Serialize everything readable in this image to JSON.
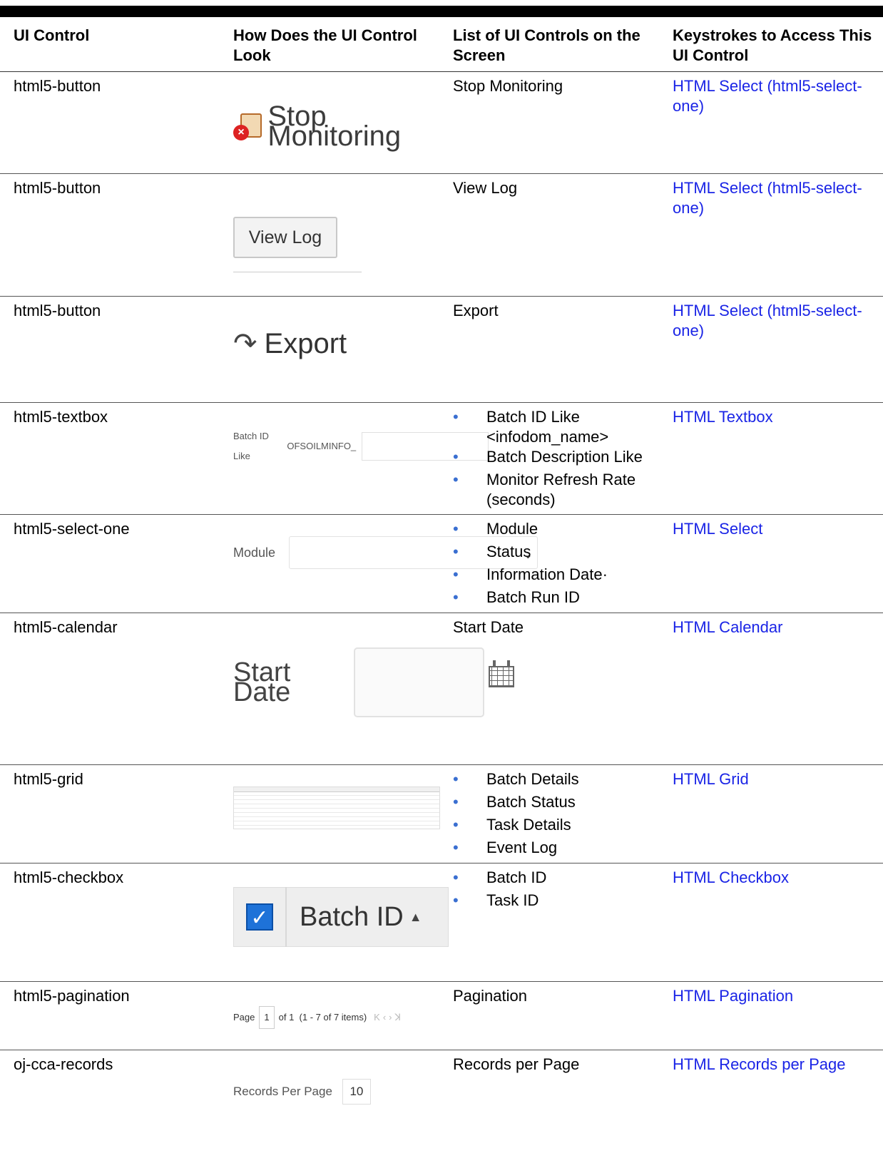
{
  "headers": {
    "c1": "UI Control",
    "c2": "How Does the UI Control Look",
    "c3": "List of UI Controls on the Screen",
    "c4": "Keystrokes to Access This UI Control"
  },
  "rows": [
    {
      "control": "html5-button",
      "screen": "Stop Monitoring",
      "keys": "HTML Select (html5-select-one)",
      "sample": {
        "label": "Stop Monitoring"
      }
    },
    {
      "control": "html5-button",
      "screen": "View Log",
      "keys": "HTML Select (html5-select-one)",
      "sample": {
        "label": "View Log"
      }
    },
    {
      "control": "html5-button",
      "screen": "Export",
      "keys": "HTML Select (html5-select-one)",
      "sample": {
        "label": "Export"
      }
    },
    {
      "control": "html5-textbox",
      "items": [
        "Batch ID Like <infodom_name>",
        "Batch Description Like",
        "Monitor Refresh Rate (seconds)"
      ],
      "keys": "HTML Textbox",
      "sample": {
        "label": "Batch ID Like",
        "value": "OFSOILMINFO_"
      }
    },
    {
      "control": "html5-select-one",
      "items": [
        "Module",
        "Status",
        "Information Date·",
        "Batch Run ID"
      ],
      "keys": "HTML Select",
      "sample": {
        "label": "Module"
      }
    },
    {
      "control": "html5-calendar",
      "screen": "Start Date",
      "keys": "HTML Calendar",
      "sample": {
        "label": "Start Date"
      }
    },
    {
      "control": "html5-grid",
      "items": [
        "Batch Details",
        "Batch Status",
        "Task Details",
        "Event Log"
      ],
      "keys": "HTML Grid"
    },
    {
      "control": "html5-checkbox",
      "items": [
        "Batch ID",
        "Task ID"
      ],
      "keys": "HTML Checkbox",
      "sample": {
        "label": "Batch ID"
      }
    },
    {
      "control": "html5-pagination",
      "screen": "Pagination",
      "keys": "HTML Pagination",
      "sample": {
        "page_label": "Page",
        "page": "1",
        "of": "of 1",
        "range": "(1 - 7 of  7  items)"
      }
    },
    {
      "control": "oj-cca-records",
      "screen": "Records per Page",
      "keys": "HTML Records per Page",
      "sample": {
        "label": "Records Per Page",
        "value": "10"
      }
    }
  ],
  "colors": {
    "link": "#1a24e6",
    "bullet": "#3a6fd1"
  }
}
